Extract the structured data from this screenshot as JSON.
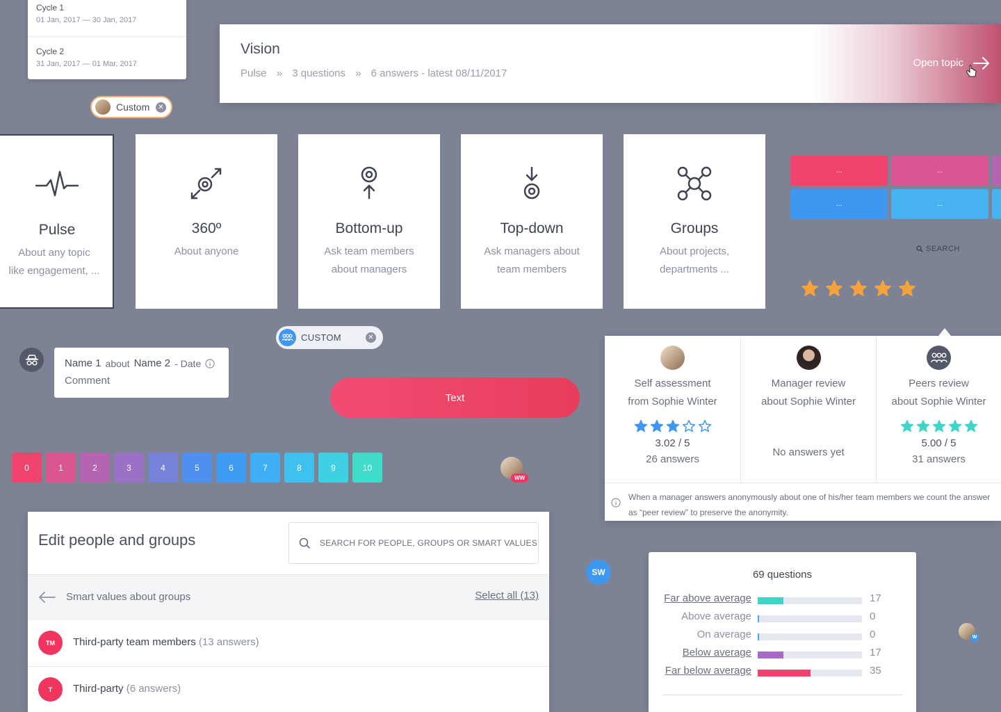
{
  "cycles": [
    {
      "name": "Cycle 1",
      "dates": "01 Jan, 2017 — 30 Jan, 2017"
    },
    {
      "name": "Cycle 2",
      "dates": "31 Jan, 2017 — 01 Mar, 2017"
    }
  ],
  "chips": {
    "custom_label": "Custom",
    "custom_caps_label": "CUSTOM"
  },
  "vision": {
    "title": "Vision",
    "crumbs": [
      "Pulse",
      "»",
      "3 questions",
      "»",
      "6 answers - latest 08/11/2017"
    ],
    "open_label": "Open topic"
  },
  "types": [
    {
      "title": "Pulse",
      "desc1": "About any topic",
      "desc2": "like engagement, ...",
      "icon": "pulse-icon"
    },
    {
      "title": "360º",
      "desc1": "About anyone",
      "desc2": "",
      "icon": "target-arrows-icon"
    },
    {
      "title": "Bottom-up",
      "desc1": "Ask team members",
      "desc2": "about managers",
      "icon": "bottom-up-icon"
    },
    {
      "title": "Top-down",
      "desc1": "Ask managers about",
      "desc2": "team members",
      "icon": "top-down-icon"
    },
    {
      "title": "Groups",
      "desc1": "About projects,",
      "desc2": "departments ...",
      "icon": "groups-network-icon"
    }
  ],
  "blocks": {
    "label": "...",
    "colors": [
      "#f0446f",
      "#d95595",
      "#3f98ef",
      "#47b2f0"
    ]
  },
  "search_link": "SEARCH",
  "comment": {
    "name1": "Name 1",
    "about": "about",
    "name2": "Name 2",
    "date": "- Date",
    "text": "Comment"
  },
  "button_text": "Text",
  "scale": {
    "values": [
      "0",
      "1",
      "2",
      "3",
      "4",
      "5",
      "6",
      "7",
      "8",
      "9",
      "10"
    ],
    "colors": [
      "#f0446f",
      "#d9568f",
      "#b565b0",
      "#9b71c5",
      "#7681d9",
      "#4e8ff0",
      "#3f9af2",
      "#3faef2",
      "#3fc1f0",
      "#3fd0e3",
      "#3fdcc9"
    ]
  },
  "badges": {
    "ww": "WW",
    "sw": "SW",
    "w": "W"
  },
  "reviews": {
    "self": {
      "line1": "Self assessment",
      "line2": "from Sophie Winter",
      "rating": 3.02,
      "score": "3.02 / 5",
      "count": "26 answers"
    },
    "manager": {
      "line1": "Manager review",
      "line2": "about Sophie Winter",
      "empty": "No answers yet"
    },
    "peers": {
      "line1": "Peers review",
      "line2": "about Sophie Winter",
      "rating": 5,
      "score": "5.00 / 5",
      "count": "31 answers"
    },
    "note": "When a manager answers anonymously about one of his/her team members we count the answer as “peer review” to preserve the anonymity."
  },
  "edit": {
    "title": "Edit people and groups",
    "search_placeholder": "SEARCH FOR PEOPLE, GROUPS OR SMART VALUES",
    "bar_title": "Smart values about groups",
    "select_all": "Select all (13)",
    "rows": [
      {
        "initials": "TM",
        "name": "Third-party team members",
        "count": "(13 answers)"
      },
      {
        "initials": "T",
        "name": "Third-party",
        "count": "(6 answers)"
      }
    ]
  },
  "questions": {
    "title": "69 questions",
    "max": 69,
    "rows": [
      {
        "label": "Far above average",
        "value": 17,
        "color": "#3fd6c9",
        "link": true
      },
      {
        "label": "Above average",
        "value": 0,
        "color": "#47a5f0",
        "link": false
      },
      {
        "label": "On average",
        "value": 0,
        "color": "#47a5f0",
        "link": false
      },
      {
        "label": "Below average",
        "value": 17,
        "color": "#a76ac6",
        "link": true
      },
      {
        "label": "Far below average",
        "value": 35,
        "color": "#f0446f",
        "link": true
      }
    ]
  }
}
